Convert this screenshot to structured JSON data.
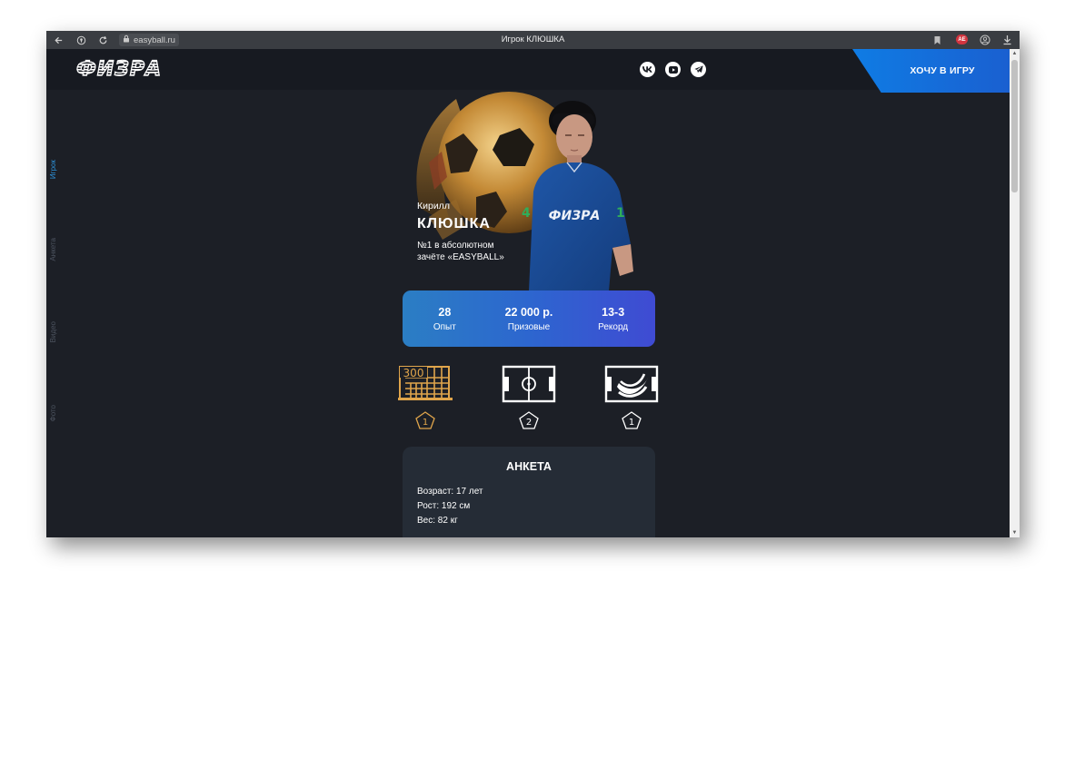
{
  "browser": {
    "url": "easyball.ru",
    "tab_title": "Игрок КЛЮШКА",
    "extension_badge": "AE"
  },
  "header": {
    "logo_text": "ФИЗРА",
    "socials": [
      {
        "icon": "vk-icon",
        "label": "VK"
      },
      {
        "icon": "youtube-icon",
        "label": "YouTube"
      },
      {
        "icon": "telegram-icon",
        "label": "Telegram"
      }
    ],
    "cta_label": "ХОЧУ В ИГРУ"
  },
  "sidenav": [
    {
      "label": "Игрок",
      "active": true
    },
    {
      "label": "Анкета",
      "active": false
    },
    {
      "label": "Видео",
      "active": false
    },
    {
      "label": "Фото",
      "active": false
    }
  ],
  "player": {
    "first_name": "Кирилл",
    "nickname": "КЛЮШКА",
    "title_line1": "№1 в абсолютном",
    "title_line2": "зачёте «EASYBALL»",
    "shirt_text": "ФИЗРА"
  },
  "stats": [
    {
      "value": "28",
      "label": "Опыт"
    },
    {
      "value": "22 000 р.",
      "label": "Призовые"
    },
    {
      "value": "13-3",
      "label": "Рекорд"
    }
  ],
  "achievements": [
    {
      "icon": "300-goal-icon",
      "icon_text": "300",
      "count": "1",
      "color": "#e0a54b"
    },
    {
      "icon": "football-field-icon",
      "count": "2",
      "color": "#ffffff"
    },
    {
      "icon": "bananas-icon",
      "count": "1",
      "color": "#ffffff"
    }
  ],
  "anketa": {
    "title": "АНКЕТА",
    "age": "Возраст: 17 лет",
    "height": "Рост: 192 см",
    "weight": "Вес: 82 кг"
  },
  "colors": {
    "page_bg": "#1c1f26",
    "header_bg": "#171a21",
    "accent": "#0f7ce4",
    "gold": "#e0a54b",
    "card_bg": "#252c36"
  }
}
